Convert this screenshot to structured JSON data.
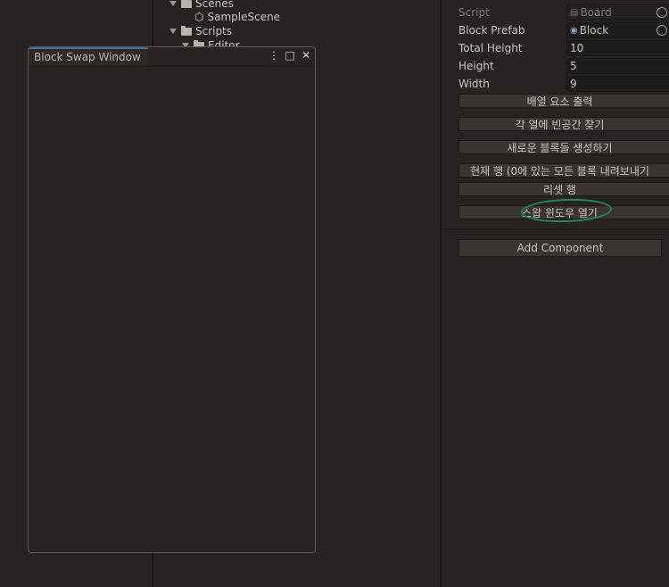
{
  "project_tree": {
    "scenes_folder": "Scenes",
    "sample_scene": "SampleScene",
    "scripts_folder": "Scripts",
    "editor_folder": "Editor"
  },
  "floating_window": {
    "title": "Block Swap Window",
    "menu_icon": "⋮",
    "maximize_icon": "□",
    "close_icon": "✕"
  },
  "inspector": {
    "fields": [
      {
        "label": "Script",
        "value": "Board",
        "icon": "script-icon",
        "disabled": true
      },
      {
        "label": "Block Prefab",
        "value": "Block",
        "icon": "prefab-icon"
      },
      {
        "label": "Total Height",
        "value": "10"
      },
      {
        "label": "Height",
        "value": "5"
      },
      {
        "label": "Width",
        "value": "9"
      }
    ],
    "buttons": [
      "배열 요소 출력",
      "각 열에 빈공간 찾기",
      "새로운 블록들 생성하기",
      "현재 행 (0에 있는 모든 블록 내려보내기",
      "리셋 행",
      "스왑 윈도우 열기"
    ],
    "add_component": "Add Component"
  },
  "colors": {
    "background": "#282220",
    "highlight_ring": "#1e8a5e",
    "tab_accent": "#3a6ea8"
  }
}
